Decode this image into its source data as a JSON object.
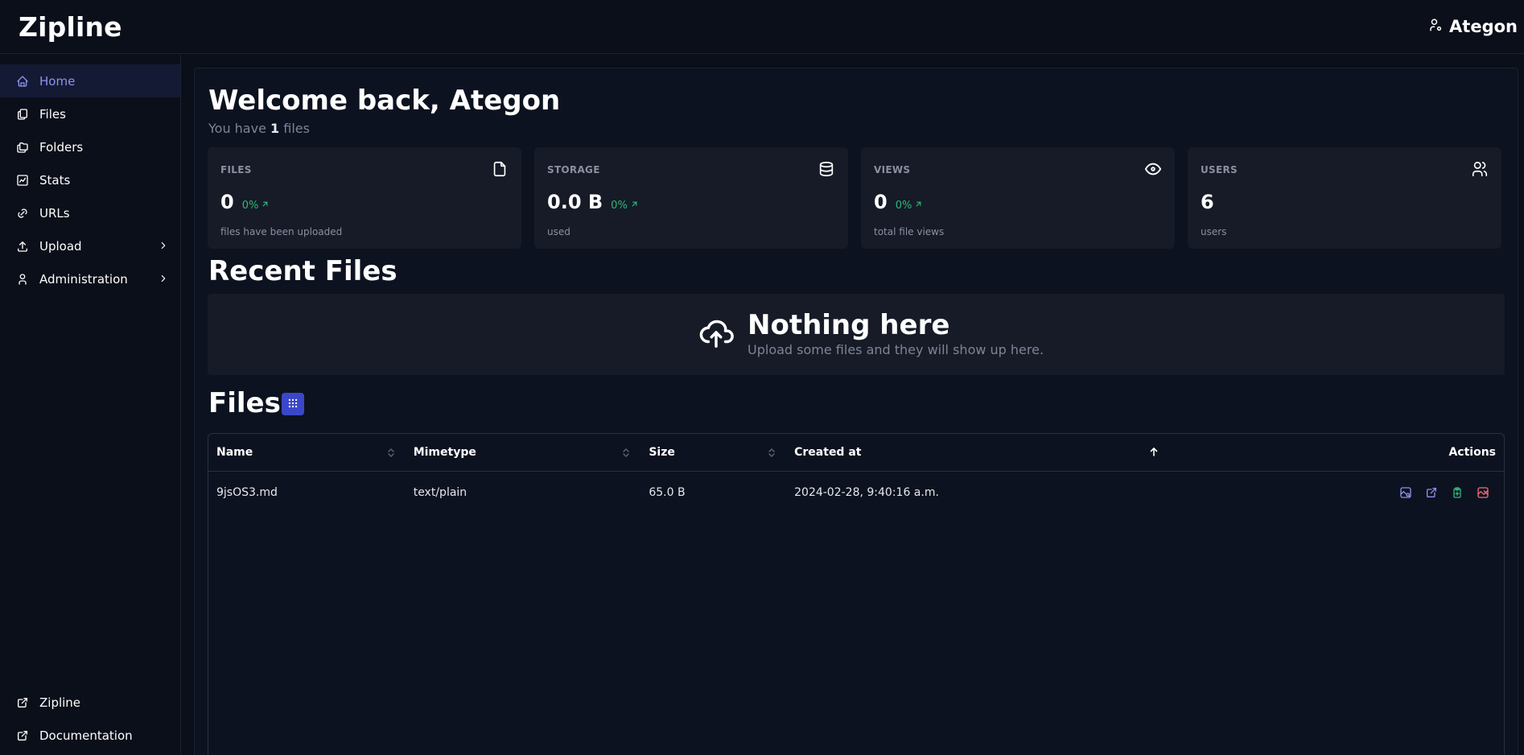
{
  "app": {
    "title": "Zipline"
  },
  "header": {
    "username": "Ategon",
    "user_icon": "user-settings-icon"
  },
  "sidebar": {
    "items": [
      {
        "label": "Home",
        "icon": "home-icon",
        "active": true
      },
      {
        "label": "Files",
        "icon": "files-icon"
      },
      {
        "label": "Folders",
        "icon": "folders-icon"
      },
      {
        "label": "Stats",
        "icon": "chart-icon"
      },
      {
        "label": "URLs",
        "icon": "link-icon"
      },
      {
        "label": "Upload",
        "icon": "upload-icon",
        "has_children": true
      },
      {
        "label": "Administration",
        "icon": "user-icon",
        "has_children": true
      }
    ],
    "bottom_items": [
      {
        "label": "Zipline",
        "icon": "external-link-icon"
      },
      {
        "label": "Documentation",
        "icon": "external-link-icon"
      }
    ]
  },
  "main": {
    "welcome": "Welcome back, Ategon",
    "subtitle_prefix": "You have ",
    "subtitle_count": "1",
    "subtitle_suffix": " files",
    "stats": [
      {
        "label": "FILES",
        "value": "0",
        "diff": "0%",
        "desc": "files have been uploaded",
        "icon": "file-icon"
      },
      {
        "label": "STORAGE",
        "value": "0.0 B",
        "diff": "0%",
        "desc": "used",
        "icon": "database-icon"
      },
      {
        "label": "VIEWS",
        "value": "0",
        "diff": "0%",
        "desc": "total file views",
        "icon": "eye-icon"
      },
      {
        "label": "USERS",
        "value": "6",
        "diff": "",
        "desc": "users",
        "icon": "users-icon"
      }
    ],
    "recent_files": {
      "title": "Recent Files",
      "empty_title": "Nothing here",
      "empty_subtitle": "Upload some files and they will show up here."
    },
    "files": {
      "title": "Files",
      "columns": [
        "Name",
        "Mimetype",
        "Size",
        "Created at",
        "Actions"
      ],
      "rows": [
        {
          "name": "9jsOS3.md",
          "mimetype": "text/plain",
          "size": "65.0 B",
          "created_at": "2024-02-28, 9:40:16 a.m."
        }
      ]
    }
  },
  "colors": {
    "accent": "#8d93ef",
    "success": "#2fb87a",
    "danger": "#f26b7a",
    "button": "#3b47c9"
  }
}
